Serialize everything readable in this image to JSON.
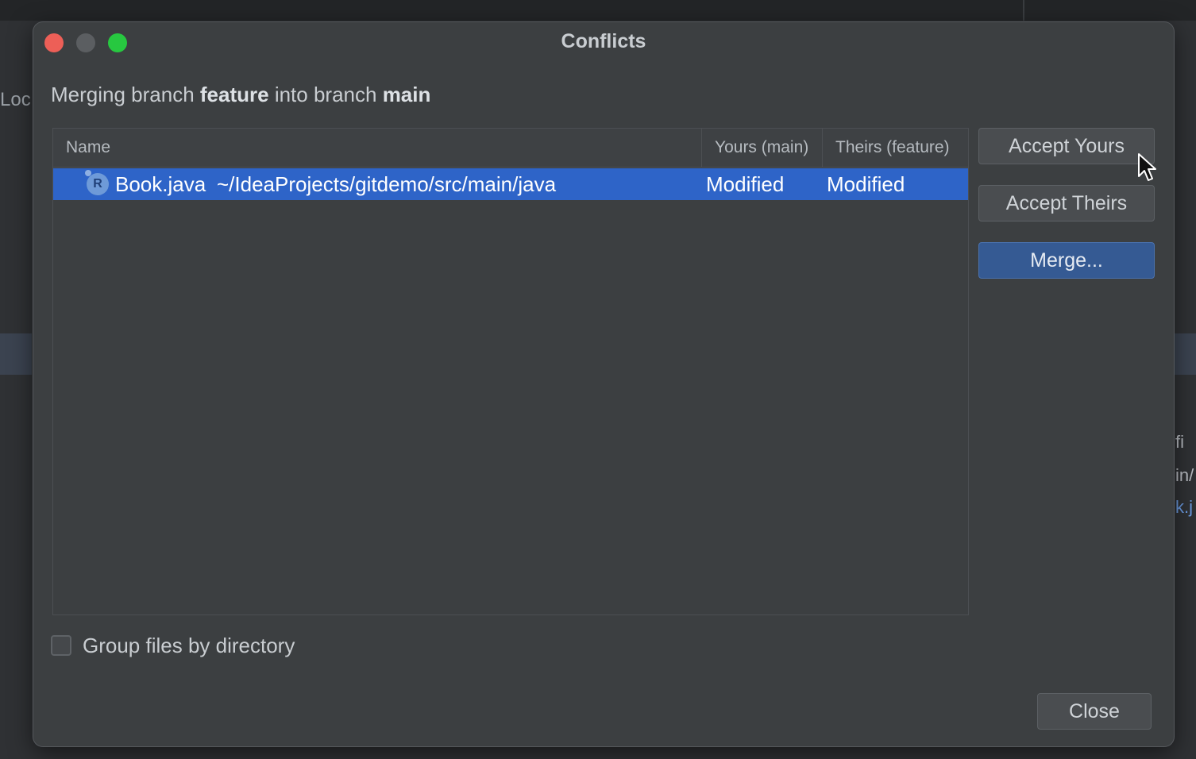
{
  "background": {
    "left_text": "Loc",
    "right_texts": [
      "fi",
      "in/",
      "k.j"
    ]
  },
  "dialog": {
    "title": "Conflicts",
    "subtitle": {
      "prefix": "Merging branch ",
      "source_branch": "feature",
      "middle": " into branch ",
      "target_branch": "main"
    }
  },
  "table": {
    "columns": [
      "Name",
      "Yours (main)",
      "Theirs (feature)"
    ],
    "rows": [
      {
        "icon": "R",
        "name": "Book.java",
        "path": "~/IdeaProjects/gitdemo/src/main/java",
        "yours": "Modified",
        "theirs": "Modified",
        "selected": true
      }
    ]
  },
  "buttons": {
    "accept_yours": "Accept Yours",
    "accept_theirs": "Accept Theirs",
    "merge": "Merge...",
    "close": "Close"
  },
  "options": {
    "group_by_directory_label": "Group files by directory",
    "group_by_directory_checked": false
  },
  "colors": {
    "selection": "#2e64c8",
    "default_button": "#355a93",
    "dialog_bg": "#3c3f41"
  }
}
